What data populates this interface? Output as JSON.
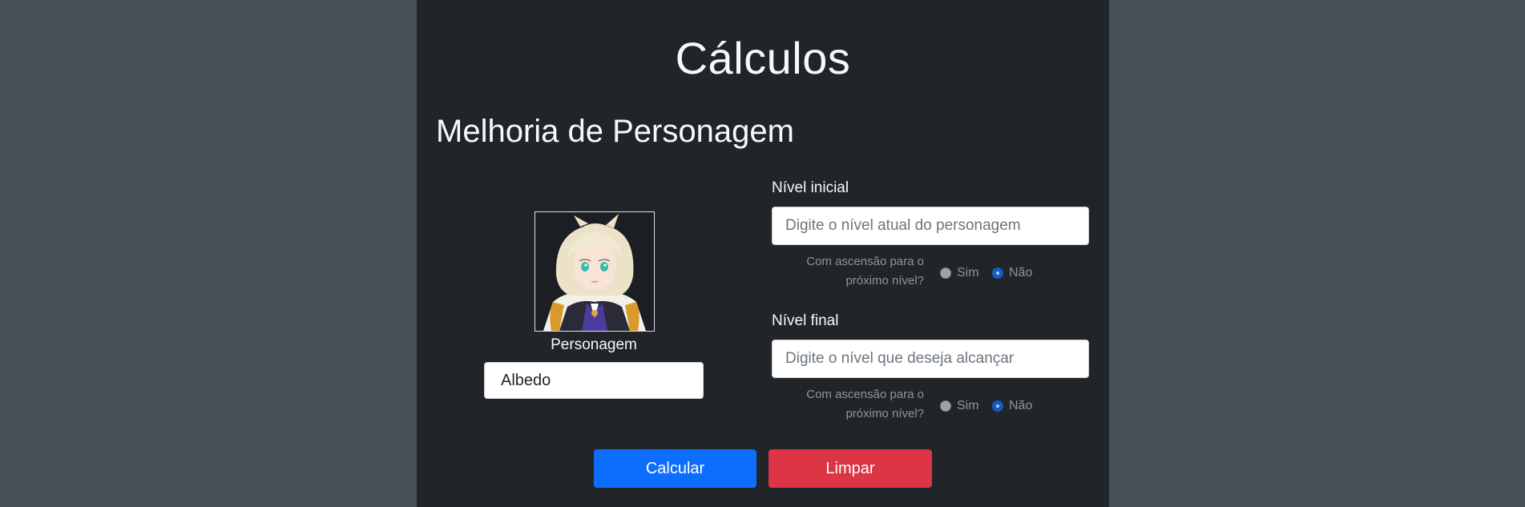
{
  "page": {
    "title": "Cálculos",
    "section_title": "Melhoria de Personagem"
  },
  "character": {
    "image_alt": "Albedo portrait",
    "label": "Personagem",
    "selected": "Albedo"
  },
  "initial_level": {
    "label": "Nível inicial",
    "placeholder": "Digite o nível atual do personagem",
    "ascension_question_line1": "Com ascensão para o",
    "ascension_question_line2": "próximo nível?",
    "option_yes": "Sim",
    "option_no": "Não",
    "selected": "Não"
  },
  "final_level": {
    "label": "Nível final",
    "placeholder": "Digite o nível que deseja alcançar",
    "ascension_question_line1": "Com ascensão para o",
    "ascension_question_line2": "próximo nível?",
    "option_yes": "Sim",
    "option_no": "Não",
    "selected": "Não"
  },
  "actions": {
    "calculate_label": "Calcular",
    "clear_label": "Limpar"
  },
  "colors": {
    "background": "#474f58",
    "panel": "#212529",
    "primary": "#0d6efd",
    "danger": "#dc3545"
  }
}
